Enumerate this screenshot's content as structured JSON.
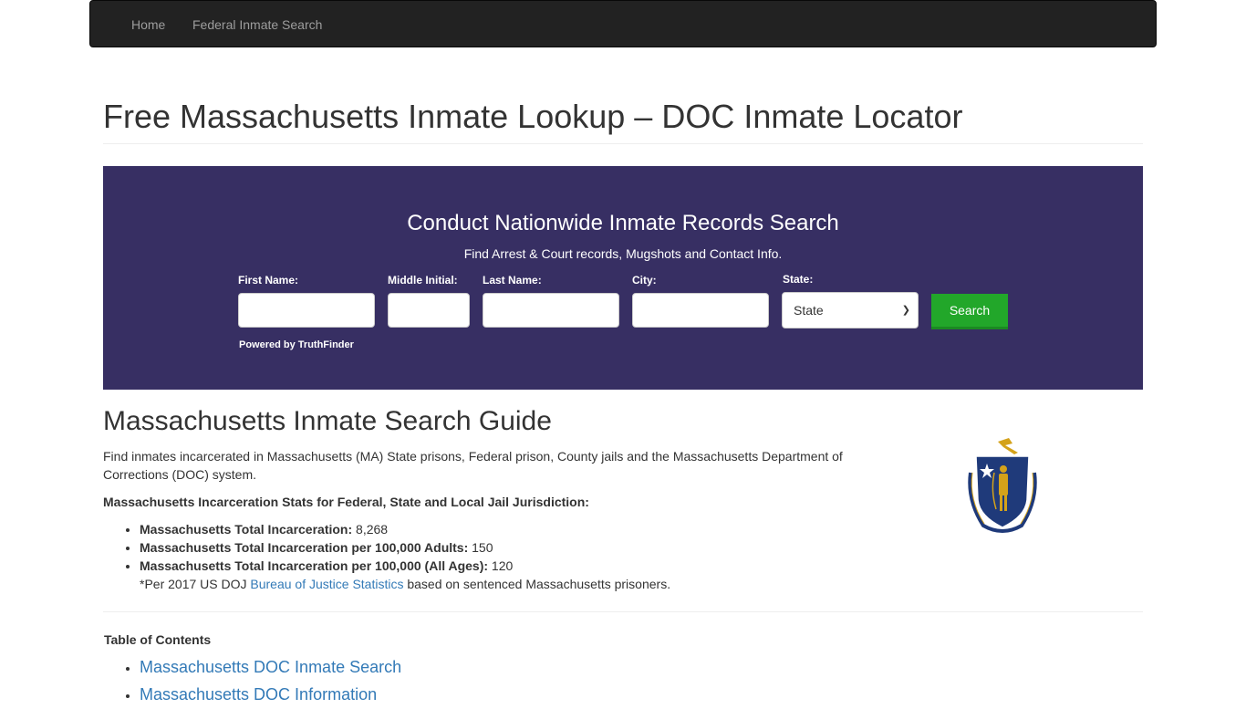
{
  "navbar": {
    "items": [
      {
        "label": "Home"
      },
      {
        "label": "Federal Inmate Search"
      }
    ]
  },
  "page": {
    "title": "Free Massachusetts Inmate Lookup – DOC Inmate Locator"
  },
  "search_panel": {
    "title": "Conduct Nationwide Inmate Records Search",
    "subtitle": "Find Arrest & Court records, Mugshots and Contact Info.",
    "fields": {
      "first_name": {
        "label": "First Name:",
        "value": ""
      },
      "middle_initial": {
        "label": "Middle Initial:",
        "value": ""
      },
      "last_name": {
        "label": "Last Name:",
        "value": ""
      },
      "city": {
        "label": "City:",
        "value": ""
      },
      "state": {
        "label": "State:",
        "selected": "State"
      }
    },
    "search_button": "Search",
    "powered_by": "Powered by TruthFinder",
    "background_color": "#372f63",
    "button_color": "#22a72a"
  },
  "guide": {
    "title": "Massachusetts Inmate Search Guide",
    "intro": "Find inmates incarcerated in Massachusetts (MA) State prisons, Federal prison, County jails and the Massachusetts Department of Corrections (DOC) system.",
    "stats_heading": "Massachusetts Incarceration Stats for Federal, State and Local Jail Jurisdiction:",
    "stats": [
      {
        "label": "Massachusetts Total Incarceration:",
        "value": "8,268"
      },
      {
        "label": "Massachusetts Total Incarceration per 100,000 Adults:",
        "value": "150"
      },
      {
        "label": "Massachusetts Total Incarceration per 100,000 (All Ages):",
        "value": "120"
      }
    ],
    "note_prefix": "*Per 2017 US DOJ ",
    "note_link": "Bureau of Justice Statistics",
    "note_suffix": " based on sentenced Massachusetts prisoners.",
    "seal_icon": "massachusetts-state-seal"
  },
  "toc": {
    "title": "Table of Contents",
    "items": [
      {
        "label": "Massachusetts DOC Inmate Search"
      },
      {
        "label": "Massachusetts DOC Information"
      }
    ]
  }
}
